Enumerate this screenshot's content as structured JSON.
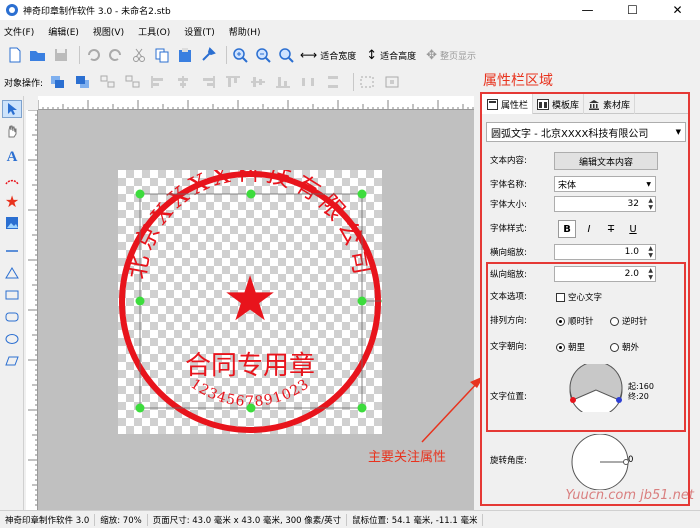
{
  "window": {
    "title": "神奇印章制作软件 3.0 - 未命名2.stb",
    "minimize": "—",
    "maximize": "☐",
    "close": "✕"
  },
  "menu": [
    "文件(F)",
    "编辑(E)",
    "视图(V)",
    "工具(O)",
    "设置(T)",
    "帮助(H)"
  ],
  "toolbar": {
    "fit_width": "适合宽度",
    "fit_height": "适合高度",
    "full_page": "整页显示"
  },
  "object_ops_label": "对象操作:",
  "annotations": {
    "panel_area": "属性栏区域",
    "main_props": "主要关注属性"
  },
  "stamp": {
    "company": "北京XXXX科技有限公司",
    "center_text": "合同专用章",
    "bottom_number": "1234567891023",
    "color": "#e8141c"
  },
  "panel": {
    "tabs": [
      "属性栏",
      "模板库",
      "素材库"
    ],
    "object_selected": "圆弧文字 - 北京XXXX科技有限公司",
    "text_content_label": "文本内容:",
    "edit_text_button": "编辑文本内容",
    "font_name_label": "字体名称:",
    "font_name": "宋体",
    "font_size_label": "字体大小:",
    "font_size": "32",
    "font_style_label": "字体样式:",
    "style_bold": "B",
    "style_italic": "I",
    "style_strike": "T",
    "style_underline": "U",
    "h_scale_label": "横向缩放:",
    "h_scale": "1.0",
    "v_scale_label": "纵向缩放:",
    "v_scale": "2.0",
    "text_options_label": "文本选项:",
    "hollow_text": "空心文字",
    "arrange_label": "排列方向:",
    "clockwise": "顺时针",
    "counterclockwise": "逆时针",
    "facing_label": "文字朝向:",
    "inward": "朝里",
    "outward": "朝外",
    "position_label": "文字位置:",
    "start": "起:160",
    "end": "终:20",
    "rotation_label": "旋转角度:",
    "rotation": "0"
  },
  "status": {
    "app": "神奇印章制作软件 3.0",
    "zoom": "缩放: 70%",
    "page_size": "页面尺寸: 43.0 毫米 x 43.0 毫米, 300 像素/英寸",
    "mouse_pos": "鼠标位置: 54.1 毫米, -11.1 毫米"
  },
  "watermark": "Yuucn.com  jb51.net"
}
